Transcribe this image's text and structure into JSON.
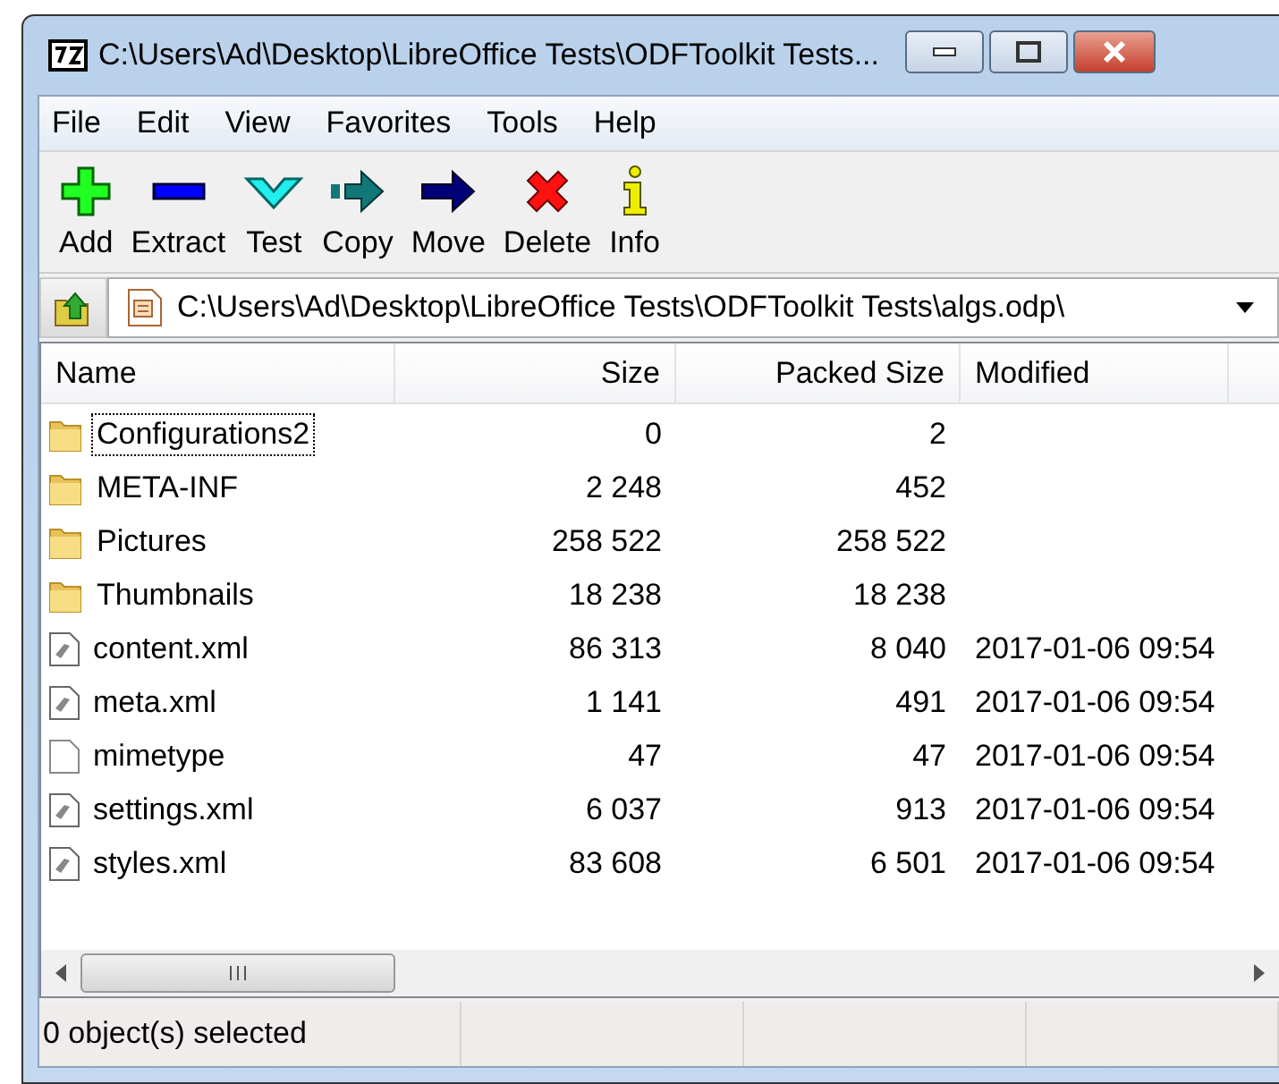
{
  "window": {
    "title": "C:\\Users\\Ad\\Desktop\\LibreOffice Tests\\ODFToolkit Tests..."
  },
  "menu": [
    "File",
    "Edit",
    "View",
    "Favorites",
    "Tools",
    "Help"
  ],
  "toolbar": [
    {
      "kind": "add",
      "label": "Add"
    },
    {
      "kind": "extract",
      "label": "Extract"
    },
    {
      "kind": "test",
      "label": "Test"
    },
    {
      "kind": "copy",
      "label": "Copy"
    },
    {
      "kind": "move",
      "label": "Move"
    },
    {
      "kind": "delete",
      "label": "Delete"
    },
    {
      "kind": "info",
      "label": "Info"
    }
  ],
  "address": {
    "value": "C:\\Users\\Ad\\Desktop\\LibreOffice Tests\\ODFToolkit Tests\\algs.odp\\"
  },
  "table": {
    "columns": [
      "Name",
      "Size",
      "Packed Size",
      "Modified"
    ],
    "rows": [
      {
        "kind": "folder",
        "focused": true,
        "name": "Configurations2",
        "size": "0",
        "packed": "2",
        "modified": ""
      },
      {
        "kind": "folder",
        "focused": false,
        "name": "META-INF",
        "size": "2 248",
        "packed": "452",
        "modified": ""
      },
      {
        "kind": "folder",
        "focused": false,
        "name": "Pictures",
        "size": "258 522",
        "packed": "258 522",
        "modified": ""
      },
      {
        "kind": "folder",
        "focused": false,
        "name": "Thumbnails",
        "size": "18 238",
        "packed": "18 238",
        "modified": ""
      },
      {
        "kind": "document",
        "focused": false,
        "name": "content.xml",
        "size": "86 313",
        "packed": "8 040",
        "modified": "2017-01-06 09:54"
      },
      {
        "kind": "document",
        "focused": false,
        "name": "meta.xml",
        "size": "1 141",
        "packed": "491",
        "modified": "2017-01-06 09:54"
      },
      {
        "kind": "blank",
        "focused": false,
        "name": "mimetype",
        "size": "47",
        "packed": "47",
        "modified": "2017-01-06 09:54"
      },
      {
        "kind": "document",
        "focused": false,
        "name": "settings.xml",
        "size": "6 037",
        "packed": "913",
        "modified": "2017-01-06 09:54"
      },
      {
        "kind": "document",
        "focused": false,
        "name": "styles.xml",
        "size": "83 608",
        "packed": "6 501",
        "modified": "2017-01-06 09:54"
      }
    ]
  },
  "status_bar": {
    "text": "0 object(s) selected"
  }
}
